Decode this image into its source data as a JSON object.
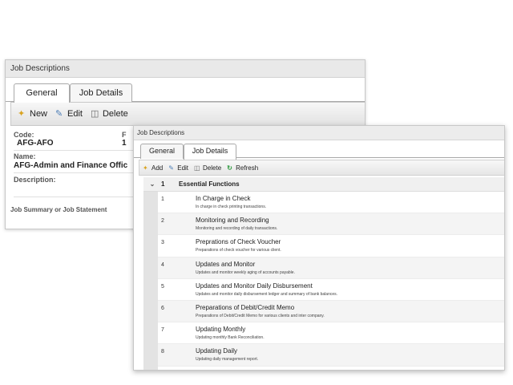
{
  "back_window": {
    "title": "Job Descriptions",
    "tabs": [
      "General",
      "Job Details"
    ],
    "toolbar": {
      "new": "New",
      "edit": "Edit",
      "delete": "Delete"
    },
    "form": {
      "code_label": "Code:",
      "code_value": "AFG-AFO",
      "name_label": "Name:",
      "name_value": "AFG-Admin and Finance Offic",
      "description_label": "Description:",
      "summary_label": "Job Summary or Job Statement",
      "col2_label": "F",
      "col2_value": "1"
    }
  },
  "front_window": {
    "title": "Job Descriptions",
    "tabs": [
      "General",
      "Job Details"
    ],
    "toolbar": {
      "add": "Add",
      "edit": "Edit",
      "delete": "Delete",
      "refresh": "Refresh"
    },
    "group": {
      "number": "1",
      "label": "Essential Functions"
    },
    "rows": [
      {
        "num": "1",
        "title": "In Charge in Check",
        "desc": "In charge in check printing transactions."
      },
      {
        "num": "2",
        "title": "Monitoring and Recording",
        "desc": "Monitoring and recording of daily transactions."
      },
      {
        "num": "3",
        "title": "Preprations of Check Voucher",
        "desc": "Preparations of check voucher for various client."
      },
      {
        "num": "4",
        "title": "Updates and Monitor",
        "desc": "Updates and monitor weekly aging of accounts payable."
      },
      {
        "num": "5",
        "title": "Updates and Monitor Daily Disbursement",
        "desc": "Updates and monitor daily disbursement ledger and summary of bank balances."
      },
      {
        "num": "6",
        "title": "Preparations of Debit/Credit Memo",
        "desc": "Preparations of Debit/Credit Memo for various clients and inter company."
      },
      {
        "num": "7",
        "title": "Updating Monthly",
        "desc": "Updating monthly Bank Reconciliation."
      },
      {
        "num": "8",
        "title": "Updating Daily",
        "desc": "Updating daily management report."
      }
    ]
  },
  "icons": {
    "new": "new-document-icon",
    "edit": "edit-pencil-icon",
    "delete": "delete-trash-icon",
    "refresh": "refresh-arrows-icon",
    "collapse": "chevron-down-icon"
  }
}
